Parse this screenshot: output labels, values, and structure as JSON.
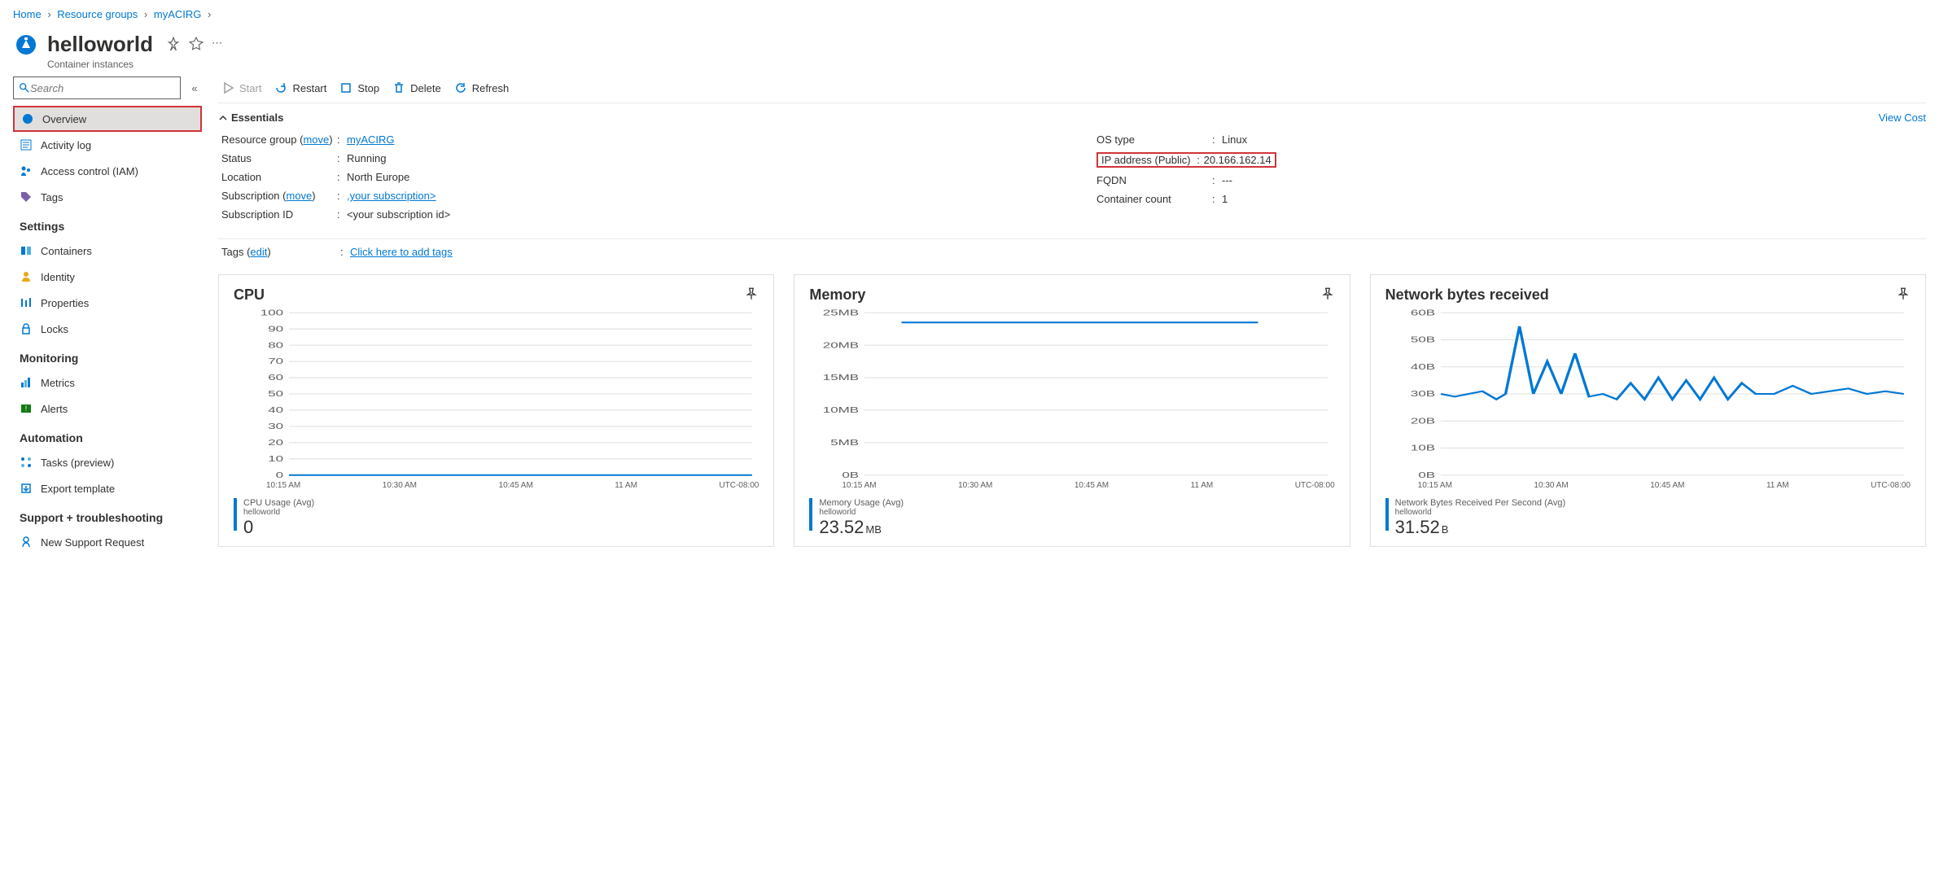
{
  "breadcrumb": {
    "home": "Home",
    "rg": "Resource groups",
    "group": "myACIRG"
  },
  "header": {
    "title": "helloworld",
    "subtitle": "Container instances"
  },
  "search": {
    "placeholder": "Search"
  },
  "sidebar": {
    "overview": "Overview",
    "activity": "Activity log",
    "iam": "Access control (IAM)",
    "tags": "Tags",
    "section_settings": "Settings",
    "containers": "Containers",
    "identity": "Identity",
    "properties": "Properties",
    "locks": "Locks",
    "section_monitoring": "Monitoring",
    "metrics": "Metrics",
    "alerts": "Alerts",
    "section_automation": "Automation",
    "tasks": "Tasks (preview)",
    "export": "Export template",
    "section_support": "Support + troubleshooting",
    "support_req": "New Support Request"
  },
  "toolbar": {
    "start": "Start",
    "restart": "Restart",
    "stop": "Stop",
    "delete": "Delete",
    "refresh": "Refresh"
  },
  "essentials": {
    "title": "Essentials",
    "view_cost": "View Cost",
    "rg_label": "Resource group (",
    "move1": "move",
    "rg_label2": ")",
    "rg_val": "myACIRG",
    "status_label": "Status",
    "status_val": "Running",
    "location_label": "Location",
    "location_val": "North Europe",
    "sub_label": "Subscription (",
    "move2": "move",
    "sub_label2": ")",
    "sub_val": ",your subscription>",
    "subid_label": "Subscription ID",
    "subid_val": "<your subscription id>",
    "os_label": "OS type",
    "os_val": "Linux",
    "ip_label": "IP address (Public)",
    "ip_val": "20.166.162.14",
    "fqdn_label": "FQDN",
    "fqdn_val": "---",
    "cc_label": "Container count",
    "cc_val": "1",
    "tags_label": "Tags (",
    "edit": "edit",
    "tags_label2": ")",
    "tags_val": "Click here to add tags"
  },
  "chart_data": [
    {
      "type": "line",
      "title": "CPU",
      "metric_name": "CPU Usage (Avg)",
      "host": "helloworld",
      "value": "0",
      "unit": "",
      "yticks": [
        "0",
        "10",
        "20",
        "30",
        "40",
        "50",
        "60",
        "70",
        "80",
        "90",
        "100"
      ],
      "xticks": [
        "10:15 AM",
        "10:30 AM",
        "10:45 AM",
        "11 AM",
        "UTC-08:00"
      ],
      "series": [
        {
          "name": "cpu",
          "points": [
            [
              0,
              0
            ],
            [
              100,
              0
            ]
          ]
        }
      ],
      "ymax": 100
    },
    {
      "type": "line",
      "title": "Memory",
      "metric_name": "Memory Usage (Avg)",
      "host": "helloworld",
      "value": "23.52",
      "unit": "MB",
      "yticks": [
        "0B",
        "5MB",
        "10MB",
        "15MB",
        "20MB",
        "25MB"
      ],
      "xticks": [
        "10:15 AM",
        "10:30 AM",
        "10:45 AM",
        "11 AM",
        "UTC-08:00"
      ],
      "series": [
        {
          "name": "mem",
          "points": [
            [
              8,
              23.5
            ],
            [
              85,
              23.5
            ]
          ]
        }
      ],
      "ymax": 25
    },
    {
      "type": "line",
      "title": "Network bytes received",
      "metric_name": "Network Bytes Received Per Second (Avg)",
      "host": "helloworld",
      "value": "31.52",
      "unit": "B",
      "yticks": [
        "0B",
        "10B",
        "20B",
        "30B",
        "40B",
        "50B",
        "60B"
      ],
      "xticks": [
        "10:15 AM",
        "10:30 AM",
        "10:45 AM",
        "11 AM",
        "UTC-08:00"
      ],
      "series": [
        {
          "name": "net",
          "points": [
            [
              0,
              30
            ],
            [
              3,
              29
            ],
            [
              6,
              30
            ],
            [
              9,
              31
            ],
            [
              12,
              28
            ],
            [
              14,
              30
            ],
            [
              17,
              55
            ],
            [
              20,
              30
            ],
            [
              23,
              42
            ],
            [
              26,
              30
            ],
            [
              29,
              45
            ],
            [
              32,
              29
            ],
            [
              35,
              30
            ],
            [
              38,
              28
            ],
            [
              41,
              34
            ],
            [
              44,
              28
            ],
            [
              47,
              36
            ],
            [
              50,
              28
            ],
            [
              53,
              35
            ],
            [
              56,
              28
            ],
            [
              59,
              36
            ],
            [
              62,
              28
            ],
            [
              65,
              34
            ],
            [
              68,
              30
            ],
            [
              72,
              30
            ],
            [
              76,
              33
            ],
            [
              80,
              30
            ],
            [
              84,
              31
            ],
            [
              88,
              32
            ],
            [
              92,
              30
            ],
            [
              96,
              31
            ],
            [
              100,
              30
            ]
          ]
        }
      ],
      "ymax": 60
    }
  ]
}
